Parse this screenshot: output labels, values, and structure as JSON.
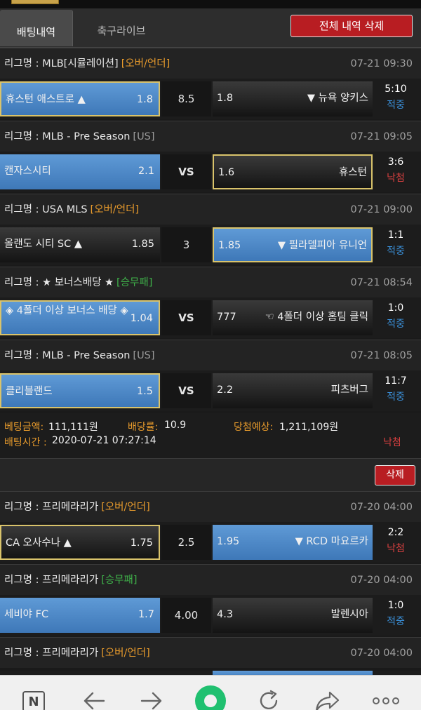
{
  "tabs": {
    "active": "배팅내역",
    "inactive": "축구라이브",
    "delete_all": "전체 내역 삭제"
  },
  "bets": [
    {
      "league": "리그명 : MLB[시뮬레이션]",
      "tag": "[오버/언더]",
      "tag_color": "orange",
      "time": "07-21 09:30",
      "home": "휴스턴 애스트로 ▲",
      "home_odd": "1.8",
      "home_style": "blue-gold",
      "mid": "8.5",
      "away": "▼ 뉴욕 양키스",
      "away_odd": "1.8",
      "away_style": "dark",
      "score": "5:10",
      "result": "적중",
      "result_type": "hit"
    },
    {
      "league": "리그명 : MLB - Pre Season",
      "tag": "[US]",
      "tag_color": "gray",
      "time": "07-21 09:05",
      "home": "캔자스시티",
      "home_odd": "2.1",
      "home_style": "blue",
      "mid": "VS",
      "away": "휴스턴",
      "away_odd": "1.6",
      "away_style": "dark-gold",
      "score": "3:6",
      "result": "낙첨",
      "result_type": "miss"
    },
    {
      "league": "리그명 : USA MLS",
      "tag": "[오버/언더]",
      "tag_color": "orange",
      "time": "07-21 09:00",
      "home": "올랜도 시티 SC ▲",
      "home_odd": "1.85",
      "home_style": "dark",
      "mid": "3",
      "away": "▼ 필라델피아 유니언",
      "away_odd": "1.85",
      "away_style": "blue-gold",
      "score": "1:1",
      "result": "적중",
      "result_type": "hit"
    },
    {
      "league": "리그명 : ★ 보너스배당 ★",
      "tag": "[승무패]",
      "tag_color": "green",
      "time": "07-21 08:54",
      "home": "◈ 4폴더 이상 보너스 배당 ◈",
      "home_odd": "1.04",
      "home_style": "blue-gold",
      "mid": "VS",
      "away": "☜ 4폴더 이상 홈팀 클릭",
      "away_odd": "777",
      "away_style": "dark",
      "score": "1:0",
      "result": "적중",
      "result_type": "hit"
    },
    {
      "league": "리그명 : MLB - Pre Season",
      "tag": "[US]",
      "tag_color": "gray",
      "time": "07-21 08:05",
      "home": "클리블랜드",
      "home_odd": "1.5",
      "home_style": "blue-gold",
      "mid": "VS",
      "away": "피츠버그",
      "away_odd": "2.2",
      "away_style": "dark",
      "score": "11:7",
      "result": "적중",
      "result_type": "hit"
    },
    {
      "league": "리그명 : 프리메라리가",
      "tag": "[오버/언더]",
      "tag_color": "orange",
      "time": "07-20 04:00",
      "home": "CA 오사수나 ▲",
      "home_odd": "1.75",
      "home_style": "dark-gold",
      "mid": "2.5",
      "away": "▼ RCD 마요르카",
      "away_odd": "1.95",
      "away_style": "blue",
      "score": "2:2",
      "result": "낙첨",
      "result_type": "miss"
    },
    {
      "league": "리그명 : 프리메라리가",
      "tag": "[승무패]",
      "tag_color": "green",
      "time": "07-20 04:00",
      "home": "세비야 FC",
      "home_odd": "1.7",
      "home_style": "blue",
      "mid": "4.00",
      "away": "발렌시아",
      "away_odd": "4.3",
      "away_style": "dark",
      "score": "1:0",
      "result": "적중",
      "result_type": "hit"
    }
  ],
  "last_league": {
    "league": "리그명 : 프리메라리가",
    "tag": "[오버/언더]",
    "time": "07-20 04:00"
  },
  "summary": {
    "amount_label": "베팅금액:",
    "amount": "111,111원",
    "rate_label": "배당률:",
    "rate": "10.9",
    "expected_label": "당첨예상:",
    "expected": "1,211,109원",
    "time_label": "배팅시간 :",
    "time": "2020-07-21 07:27:14",
    "result": "낙첨"
  },
  "delete_label": "삭제",
  "toolbar": {
    "n_label": "N"
  },
  "colors": {
    "accent_red": "#b81d22",
    "blue": "#4a86c8",
    "orange": "#e89b2c",
    "green": "#3fb24a",
    "hit": "#3a8fd8",
    "miss": "#d94040"
  }
}
